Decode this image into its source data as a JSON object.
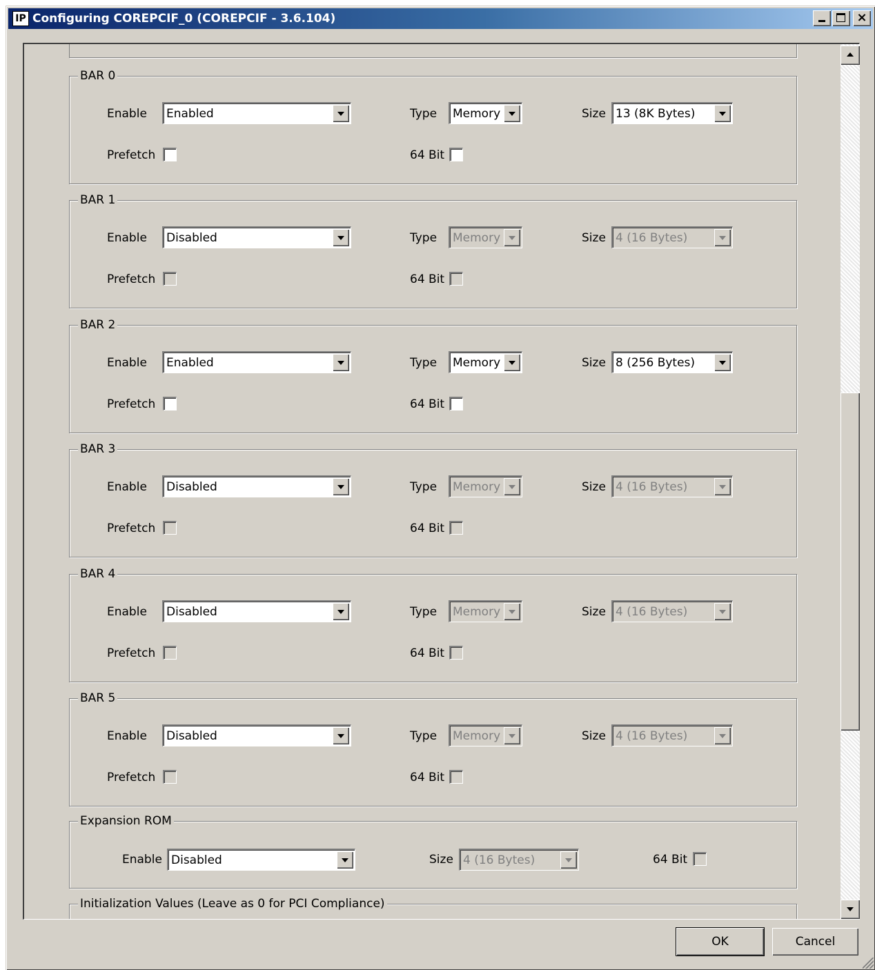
{
  "window": {
    "icon_text": "IP",
    "title": "Configuring COREPCIF_0 (COREPCIF - 3.6.104)",
    "close_glyph": "×"
  },
  "labels": {
    "enable": "Enable",
    "type": "Type",
    "size": "Size",
    "prefetch": "Prefetch",
    "bit64": "64 Bit"
  },
  "bars": [
    {
      "legend": "BAR 0",
      "enable": "Enabled",
      "type": "Memory",
      "size": "13 (8K Bytes)",
      "prefetch": false,
      "bit64": false,
      "disabled": false
    },
    {
      "legend": "BAR 1",
      "enable": "Disabled",
      "type": "Memory",
      "size": "4  (16 Bytes)",
      "prefetch": false,
      "bit64": false,
      "disabled": true
    },
    {
      "legend": "BAR 2",
      "enable": "Enabled",
      "type": "Memory",
      "size": "8  (256 Bytes)",
      "prefetch": false,
      "bit64": false,
      "disabled": false
    },
    {
      "legend": "BAR 3",
      "enable": "Disabled",
      "type": "Memory",
      "size": "4  (16 Bytes)",
      "prefetch": false,
      "bit64": false,
      "disabled": true
    },
    {
      "legend": "BAR 4",
      "enable": "Disabled",
      "type": "Memory",
      "size": "4  (16 Bytes)",
      "prefetch": false,
      "bit64": false,
      "disabled": true
    },
    {
      "legend": "BAR 5",
      "enable": "Disabled",
      "type": "Memory",
      "size": "4  (16 Bytes)",
      "prefetch": false,
      "bit64": false,
      "disabled": true
    }
  ],
  "expansion_rom": {
    "legend": "Expansion ROM",
    "enable": "Disabled",
    "size": "4  (16 Bytes)",
    "bit64": false
  },
  "init_values": {
    "legend": "Initialization Values (Leave as 0 for PCI Compliance)"
  },
  "buttons": {
    "ok": "OK",
    "cancel": "Cancel"
  }
}
